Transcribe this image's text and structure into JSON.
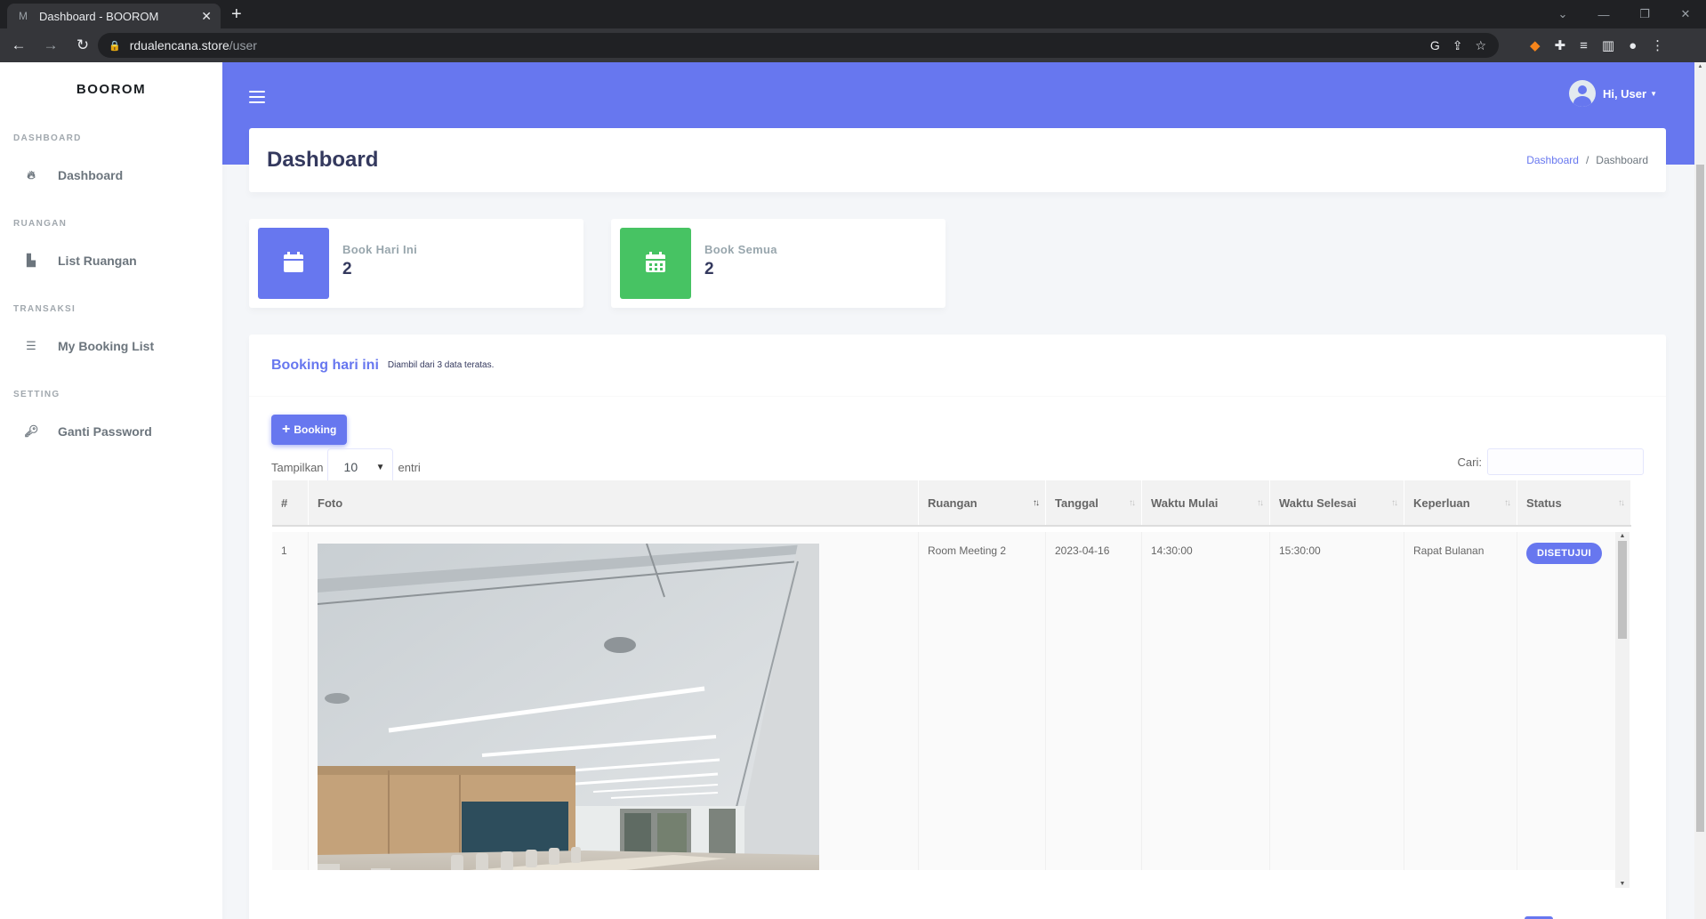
{
  "browser": {
    "tab_title": "Dashboard - BOOROM",
    "tab_favicon": "M",
    "url_host": "rdualencana.store",
    "url_path": "/user"
  },
  "sidebar": {
    "brand": "BOOROM",
    "sections": [
      {
        "header": "DASHBOARD",
        "item": "Dashboard",
        "icon": "fire-icon"
      },
      {
        "header": "RUANGAN",
        "item": "List Ruangan",
        "icon": "door-icon"
      },
      {
        "header": "TRANSAKSI",
        "item": "My Booking List",
        "icon": "list-icon"
      },
      {
        "header": "SETTING",
        "item": "Ganti Password",
        "icon": "key-icon"
      }
    ]
  },
  "navbar": {
    "user_greeting": "Hi, User"
  },
  "header": {
    "title": "Dashboard",
    "breadcrumb": [
      "Dashboard",
      "/",
      "Dashboard"
    ]
  },
  "stats": [
    {
      "label": "Book Hari Ini",
      "value": "2",
      "color": "#6777ef",
      "icon": "calendar-icon"
    },
    {
      "label": "Book Semua",
      "value": "2",
      "color": "#47c363",
      "icon": "calendar-grid-icon"
    }
  ],
  "booking_card": {
    "title": "Booking hari ini",
    "subtitle": "Diambil dari 3 data teratas.",
    "add_button": "Booking",
    "length_prefix": "Tampilkan",
    "length_value": "10",
    "length_suffix": "entri",
    "search_label": "Cari:",
    "search_value": "",
    "columns": [
      "#",
      "Foto",
      "Ruangan",
      "Tanggal",
      "Waktu Mulai",
      "Waktu Selesai",
      "Keperluan",
      "Status"
    ],
    "rows": [
      {
        "no": "1",
        "ruangan": "Room Meeting 2",
        "tanggal": "2023-04-16",
        "waktu_mulai": "14:30:00",
        "waktu_selesai": "15:30:00",
        "keperluan": "Rapat Bulanan",
        "status": "DISETUJUI"
      }
    ]
  },
  "colors": {
    "primary": "#6777ef",
    "success": "#47c363",
    "background": "#f4f6f9"
  }
}
